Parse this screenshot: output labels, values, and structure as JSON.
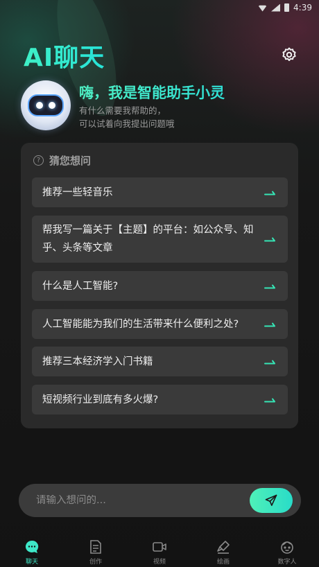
{
  "status_bar": {
    "time": "4:39"
  },
  "app": {
    "title": "AI聊天"
  },
  "hero": {
    "greeting": "嗨，我是智能助手小灵",
    "sub_line1": "有什么需要我帮助的，",
    "sub_line2": "可以试着向我提出问题哦"
  },
  "suggestions": {
    "title": "猜您想问",
    "items": [
      {
        "text": "推荐一些轻音乐"
      },
      {
        "text": "帮我写一篇关于【主题】的平台：如公众号、知乎、头条等文章"
      },
      {
        "text": "什么是人工智能?"
      },
      {
        "text": "人工智能能为我们的生活带来什么便利之处?"
      },
      {
        "text": "推荐三本经济学入门书籍"
      },
      {
        "text": "短视频行业到底有多火爆?"
      }
    ]
  },
  "input": {
    "placeholder": "请输入想问的...",
    "value": ""
  },
  "tabs": [
    {
      "label": "聊天",
      "icon": "chat-icon",
      "active": true
    },
    {
      "label": "创作",
      "icon": "document-icon",
      "active": false
    },
    {
      "label": "视频",
      "icon": "video-icon",
      "active": false
    },
    {
      "label": "绘画",
      "icon": "brush-icon",
      "active": false
    },
    {
      "label": "数字人",
      "icon": "face-icon",
      "active": false
    }
  ],
  "colors": {
    "accent": "#3ee8c8",
    "background": "#151515",
    "card": "#2a2a2a",
    "item": "#3a3a3a"
  }
}
